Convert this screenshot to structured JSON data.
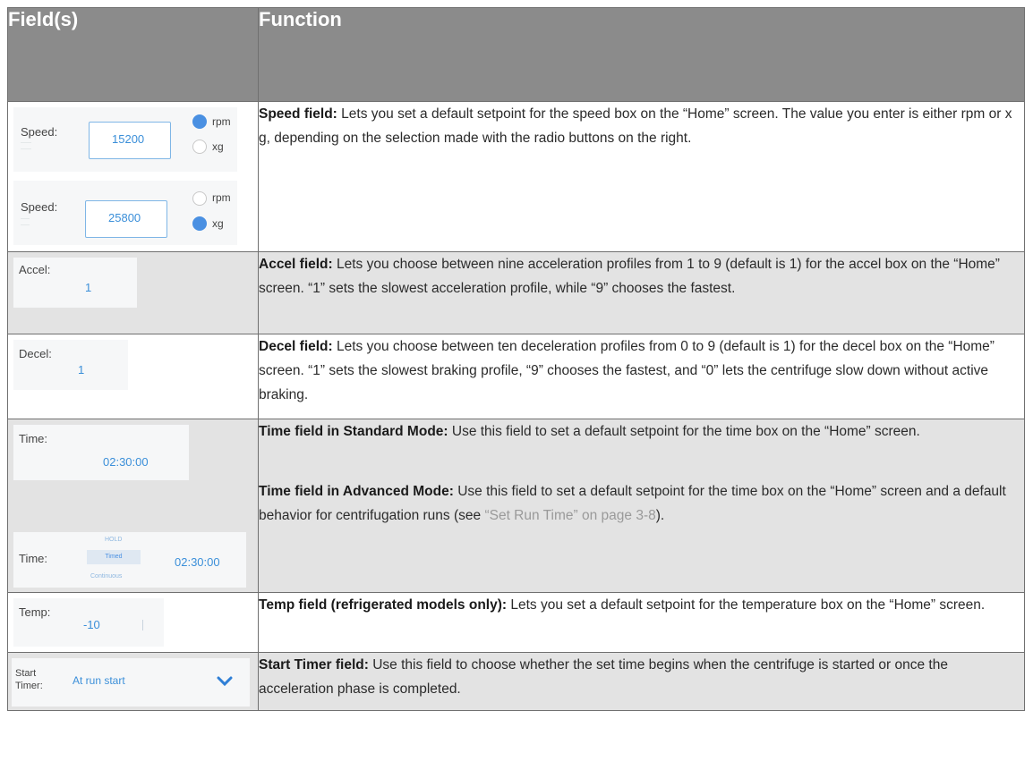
{
  "header": {
    "col1": "Field(s)",
    "col2": "Function"
  },
  "rows": {
    "speed": {
      "title": "Speed field:",
      "text": " Lets you set a default setpoint for the speed box on the “Home” screen. The value you enter is either rpm or x g, depending on the selection made with the radio buttons on the right.",
      "shot1": {
        "label": "Speed:",
        "value": "15200",
        "radio1": "rpm",
        "radio2": "xg",
        "selected": "rpm"
      },
      "shot2": {
        "label": "Speed:",
        "value": "25800",
        "radio1": "rpm",
        "radio2": "xg",
        "selected": "xg"
      }
    },
    "accel": {
      "title": "Accel field:",
      "text": " Lets you choose between nine acceleration profiles from 1 to 9 (default is 1) for the accel box on the “Home” screen. “1” sets the slowest acceleration profile, while “9” chooses the fastest.",
      "shot": {
        "label": "Accel:",
        "value": "1"
      }
    },
    "decel": {
      "title": "Decel field:",
      "text": " Lets you choose between ten deceleration profiles from 0 to 9 (default is 1) for the decel box on the “Home” screen. “1” sets the slowest braking profile, “9” chooses the fastest, and “0” lets the centrifuge slow down without active braking.",
      "shot": {
        "label": "Decel:",
        "value": "1"
      }
    },
    "time": {
      "title_std": "Time field in Standard Mode:",
      "text_std": " Use this field to set a default setpoint for the time box on the “Home” screen.",
      "title_adv": "Time field in Advanced Mode:",
      "text_adv": " Use this field to set a default setpoint for the time box on the “Home” screen and a default behavior for centrifugation runs (see ",
      "link": "“Set Run Time” on page 3-8",
      "text_adv_end": ").",
      "shot_std": {
        "label": "Time:",
        "value": "02:30:00"
      },
      "shot_adv": {
        "label": "Time:",
        "value": "02:30:00",
        "mode_top": "HOLD",
        "mode_selected": "Timed",
        "mode_bottom": "Continuous"
      }
    },
    "temp": {
      "title": "Temp field (refrigerated models only):",
      "text": " Lets you set a default setpoint for the temperature box on the “Home” screen.",
      "shot": {
        "label": "Temp:",
        "value": "-10"
      }
    },
    "start_timer": {
      "title": "Start Timer field:",
      "text": " Use this field to choose whether the set time begins when the centrifuge is started or once the acceleration phase is completed.",
      "shot": {
        "label_line1": "Start",
        "label_line2": "Timer:",
        "value": "At run start"
      }
    }
  },
  "colors": {
    "header_bg": "#8b8b8b",
    "alt_row_bg": "#e3e3e3",
    "accent_blue": "#4a90e2",
    "link_gray": "#9a9a9a"
  }
}
